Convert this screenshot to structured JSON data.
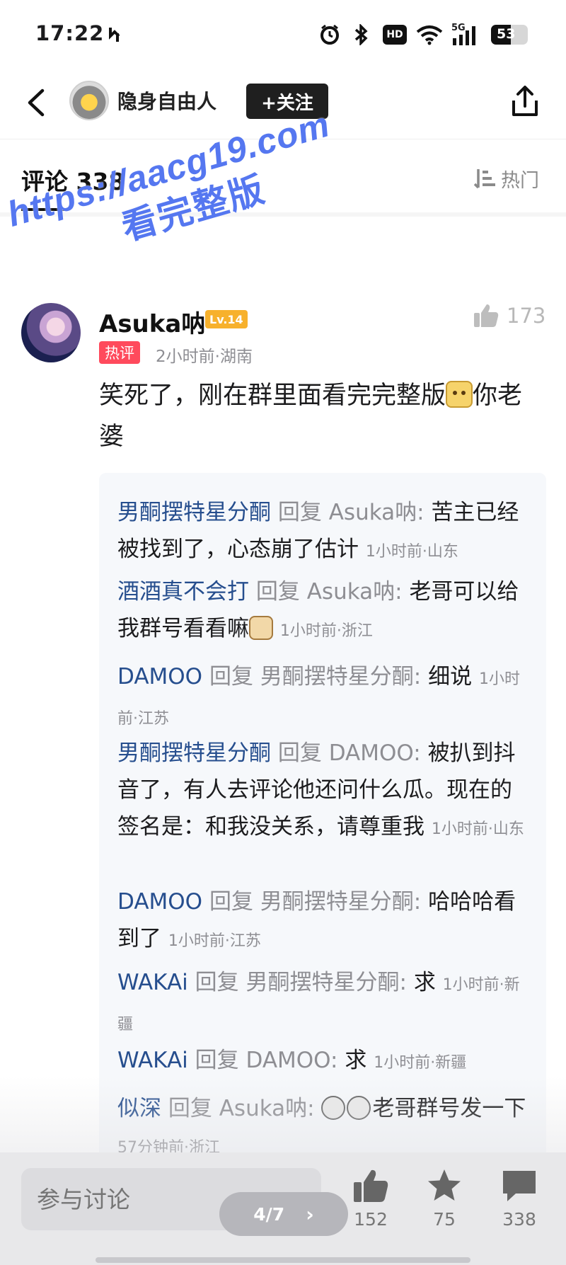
{
  "status_bar": {
    "time": "17:22",
    "battery": "53",
    "icons": [
      "sync-icon",
      "alarm-icon",
      "bluetooth-icon",
      "hd-icon",
      "wifi-icon",
      "5g-signal-icon",
      "battery-icon"
    ],
    "hd_label": "HD",
    "network_label": "5G"
  },
  "header": {
    "author_name": "隐身自由人",
    "follow_label": "+关注"
  },
  "tabs": {
    "comments_label": "评论 338",
    "sort_label": "热门"
  },
  "watermark": {
    "url": "https://aacg19.com",
    "text": "看完整版"
  },
  "comment": {
    "user": "Asuka呐",
    "level": "Lv.14",
    "hot_tag": "热评",
    "meta": "2小时前·湖南",
    "likes": "173",
    "text_before_emoji": "笑死了，刚在群里面看完完整版",
    "text_after_emoji": "你老婆"
  },
  "replies": [
    {
      "user": "男酮摆特星分酮",
      "reply_word": "回复",
      "target": "Asuka呐:",
      "text": "苦主已经被找到了，心态崩了估计",
      "time": "1小时前·山东"
    },
    {
      "user": "酒酒真不会打",
      "reply_word": "回复",
      "target": "Asuka呐:",
      "text": "老哥可以给我群号看看嘛",
      "time": "1小时前·浙江"
    },
    {
      "user": "DAMOO",
      "reply_word": "回复",
      "target": "男酮摆特星分酮:",
      "text": "细说",
      "time": "1小时前·江苏"
    },
    {
      "user": "男酮摆特星分酮",
      "reply_word": "回复",
      "target": "DAMOO:",
      "text": "被扒到抖音了，有人去评论他还问什么瓜。现在的签名是：和我没关系，请尊重我",
      "time": "1小时前·山东"
    },
    {
      "user": "DAMOO",
      "reply_word": "回复",
      "target": "男酮摆特星分酮:",
      "text": "哈哈哈看到了",
      "time": "1小时前·江苏"
    },
    {
      "user": "WAKAi",
      "reply_word": "回复",
      "target": "男酮摆特星分酮:",
      "text": "求",
      "time": "1小时前·新疆"
    },
    {
      "user": "WAKAi",
      "reply_word": "回复",
      "target": "DAMOO:",
      "text": "求",
      "time": "1小时前·新疆"
    },
    {
      "user": "似深",
      "reply_word": "回复",
      "target": "Asuka呐:",
      "text": "老哥群号发一下",
      "time": "57分钟前·浙江"
    }
  ],
  "bottom_bar": {
    "input_placeholder": "参与讨论",
    "page_indicator": "4/7",
    "like_count": "152",
    "favorite_count": "75",
    "comment_count": "338"
  }
}
